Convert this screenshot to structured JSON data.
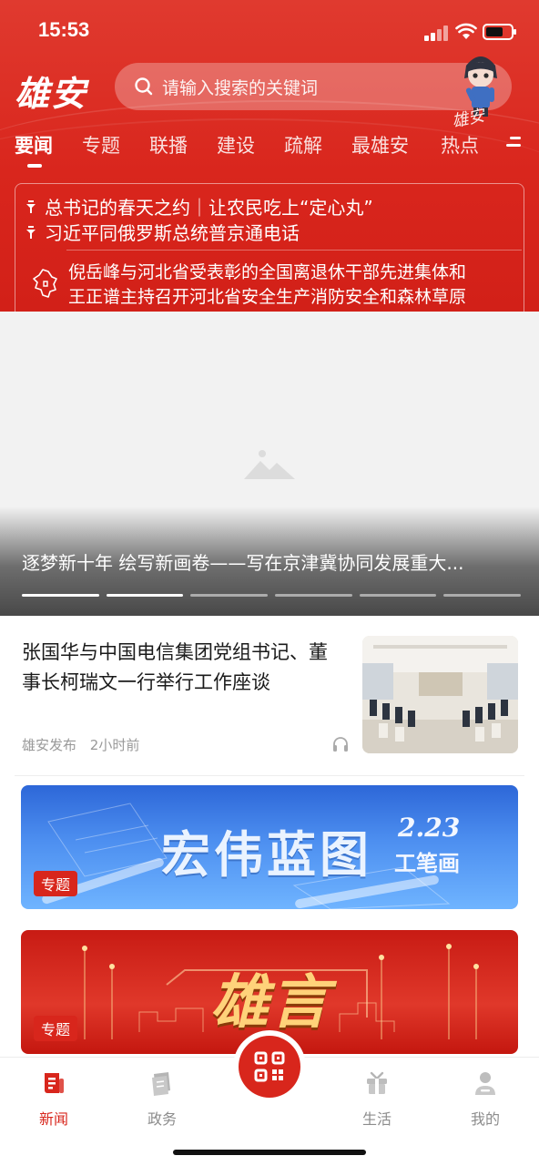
{
  "status_bar": {
    "time": "15:53"
  },
  "header": {
    "logo": "雄安",
    "search_placeholder": "请输入搜索的关键词",
    "mascot_label": "雄安"
  },
  "tabs": [
    {
      "label": "要闻",
      "active": true
    },
    {
      "label": "专题",
      "active": false
    },
    {
      "label": "联播",
      "active": false
    },
    {
      "label": "建设",
      "active": false
    },
    {
      "label": "疏解",
      "active": false
    },
    {
      "label": "最雄安",
      "active": false
    },
    {
      "label": "热点",
      "active": false
    }
  ],
  "pinned_news": [
    "总书记的春天之约｜让农民吃上“定心丸”",
    "习近平同俄罗斯总统普京通电话"
  ],
  "ticker": [
    "倪岳峰与河北省受表彰的全国离退休干部先进集体和",
    "王正谱主持召开河北省安全生产消防安全和森林草原"
  ],
  "carousel": {
    "caption": "逐梦新十年 绘写新画卷——写在京津冀协同发展重大...",
    "dots": 6,
    "active_dots": 2
  },
  "article": {
    "title": "张国华与中国电信集团党组书记、董事长柯瑞文一行举行工作座谈",
    "source": "雄安发布",
    "time": "2小时前"
  },
  "specials": [
    {
      "title": "宏伟蓝图",
      "date": "2.23",
      "subtitle": "工笔画",
      "tag": "专题"
    },
    {
      "title": "雄言",
      "tag": "专题"
    }
  ],
  "bottom_nav": [
    {
      "label": "新闻",
      "icon": "news-icon",
      "active": true
    },
    {
      "label": "政务",
      "icon": "gov-book-icon",
      "active": false
    },
    {
      "label": "生活",
      "icon": "gift-icon",
      "active": false
    },
    {
      "label": "我的",
      "icon": "user-icon",
      "active": false
    }
  ],
  "colors": {
    "brand_red": "#d8261c",
    "muted": "#8c8c8c"
  }
}
